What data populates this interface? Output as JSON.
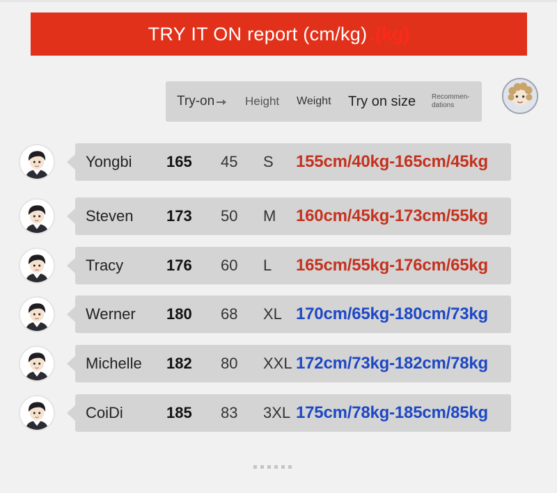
{
  "banner": {
    "title": "TRY IT ON report (cm/kg)",
    "smudge": ".(kg)"
  },
  "header": {
    "try_on": "Try-on",
    "height": "Height",
    "weight": "Weight",
    "size": "Try on size",
    "recommendations": "Recommen-\ndations"
  },
  "colors": {
    "banner": "#e2311a",
    "range_red": "#c4321f",
    "range_blue": "#1e48c4",
    "bar": "#d4d4d4"
  },
  "rows": [
    {
      "name": "Yongbi",
      "height": "165",
      "weight": "45",
      "size": "S",
      "range": "155cm/40kg-165cm/45kg",
      "tone": "red"
    },
    {
      "name": "Steven",
      "height": "173",
      "weight": "50",
      "size": "M",
      "range": "160cm/45kg-173cm/55kg",
      "tone": "red"
    },
    {
      "name": "Tracy",
      "height": "176",
      "weight": "60",
      "size": "L",
      "range": "165cm/55kg-176cm/65kg",
      "tone": "red"
    },
    {
      "name": "Werner",
      "height": "180",
      "weight": "68",
      "size": "XL",
      "range": "170cm/65kg-180cm/73kg",
      "tone": "blue"
    },
    {
      "name": "Michelle",
      "height": "182",
      "weight": "80",
      "size": "XXL",
      "range": "172cm/73kg-182cm/78kg",
      "tone": "blue"
    },
    {
      "name": "CoiDi",
      "height": "185",
      "weight": "83",
      "size": "3XL",
      "range": "175cm/78kg-185cm/85kg",
      "tone": "blue"
    }
  ]
}
